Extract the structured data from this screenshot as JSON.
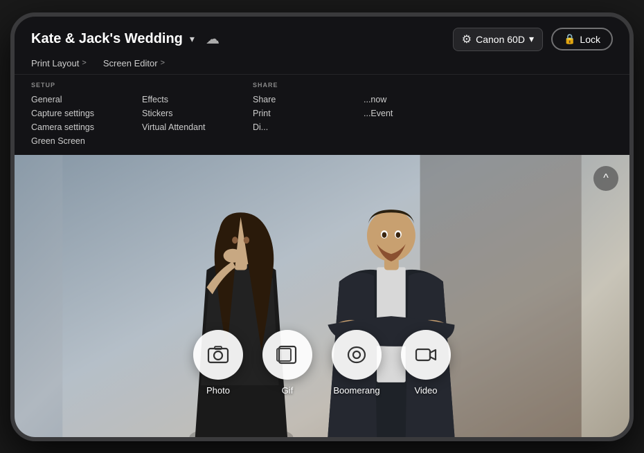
{
  "device": {
    "border_color": "#3a3a3c"
  },
  "header": {
    "project_title": "Kate & Jack's Wedding",
    "chevron": "▾",
    "cloud_label": "cloud",
    "camera_label": "Canon 60D",
    "camera_chevron": "▾",
    "lock_label": "Lock"
  },
  "nav": {
    "items": [
      {
        "label": "Print Layout",
        "arrow": ">"
      },
      {
        "label": "Screen Editor",
        "arrow": ">"
      }
    ]
  },
  "setup_menu": {
    "label": "SETUP",
    "items": [
      "General",
      "Capture settings",
      "Camera settings",
      "Green Screen"
    ]
  },
  "effects_menu": {
    "items": [
      "Effects",
      "Stickers",
      "Virtual Attendant"
    ]
  },
  "share_menu": {
    "label": "SHARE",
    "items": [
      "Share",
      "Print",
      "Di..."
    ]
  },
  "share_extra": {
    "items": [
      "...now",
      "...Event"
    ]
  },
  "capture_buttons": [
    {
      "label": "Photo",
      "icon": "📷"
    },
    {
      "label": "Gif",
      "icon": "🖼"
    },
    {
      "label": "Boomerang",
      "icon": "∞"
    },
    {
      "label": "Video",
      "icon": "📹"
    }
  ],
  "scroll_up": "^"
}
